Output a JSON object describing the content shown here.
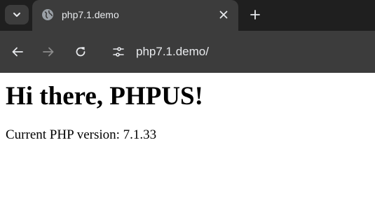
{
  "browser": {
    "tab": {
      "title": "php7.1.demo"
    },
    "address_bar": {
      "url": "php7.1.demo/"
    },
    "colors": {
      "tabstrip_bg": "#1f1f1f",
      "toolbar_bg": "#3c3c3c",
      "text": "#e8eaed"
    }
  },
  "page": {
    "heading": "Hi there, PHPUS!",
    "version_text": "Current PHP version: 7.1.33"
  }
}
